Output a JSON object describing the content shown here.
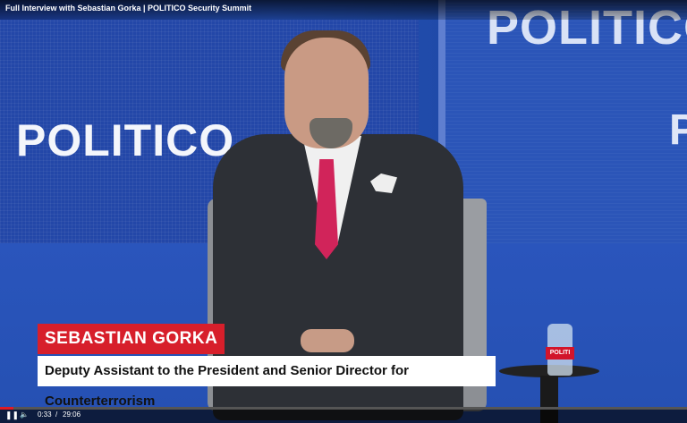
{
  "video": {
    "title": "Full Interview with Sebastian Gorka | POLITICO Security Summit"
  },
  "backdrop": {
    "logo_main": "POLITICO",
    "logo_top": "POLITICO",
    "logo_right": "P"
  },
  "prop": {
    "bottle_label": "POLITI"
  },
  "lower_third": {
    "name": "SEBASTIAN GORKA",
    "title": "Deputy Assistant to the President and Senior Director for Counterterrorism"
  },
  "player": {
    "current_time": "0:33",
    "separator": "/",
    "duration": "29:06",
    "progress": 0.019,
    "play_icon": "pause-icon",
    "volume_icon": "volume-icon",
    "accent": "#e01b24"
  }
}
